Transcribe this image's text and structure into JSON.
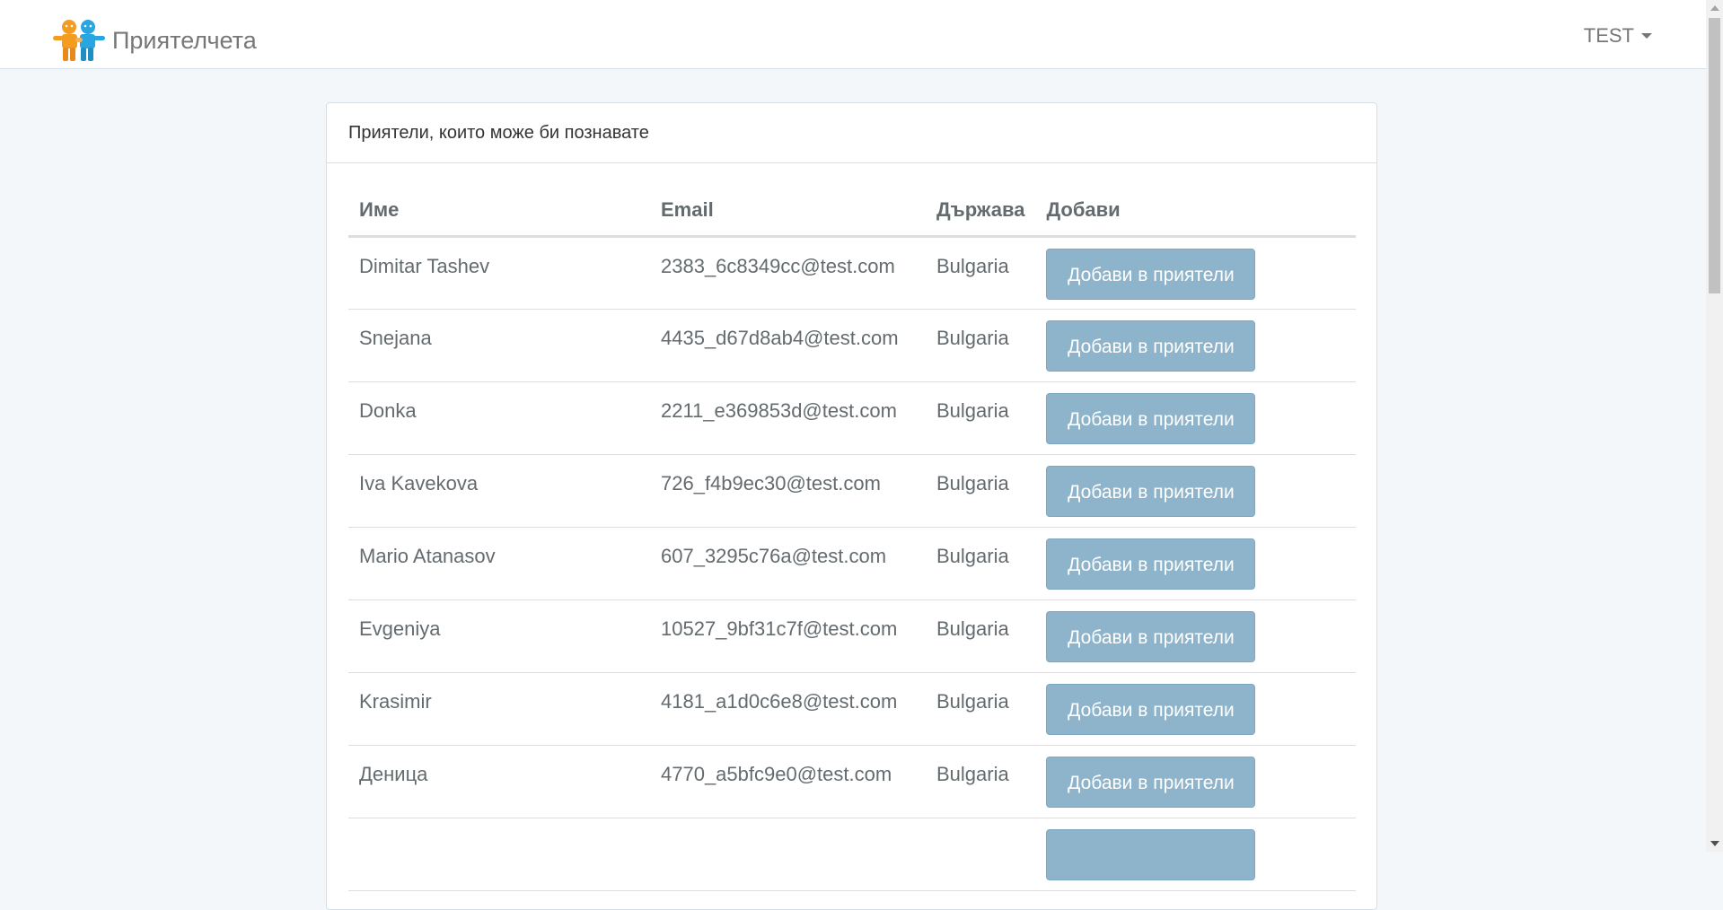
{
  "navbar": {
    "brand": "Приятелчета",
    "logo_icon": "friends-logo-icon",
    "user": "TEST"
  },
  "panel": {
    "heading": "Приятели, които може би познавате"
  },
  "table": {
    "headers": {
      "name": "Име",
      "email": "Email",
      "country": "Държава",
      "action": "Добави"
    },
    "rows": [
      {
        "name": "Dimitar Tashev",
        "email": "2383_6c8349cc@test.com",
        "country": "Bulgaria",
        "button": "Добави в приятели"
      },
      {
        "name": "Snejana",
        "email": "4435_d67d8ab4@test.com",
        "country": "Bulgaria",
        "button": "Добави в приятели"
      },
      {
        "name": "Donka",
        "email": "2211_e369853d@test.com",
        "country": "Bulgaria",
        "button": "Добави в приятели"
      },
      {
        "name": "Iva Kavekova",
        "email": "726_f4b9ec30@test.com",
        "country": "Bulgaria",
        "button": "Добави в приятели"
      },
      {
        "name": "Mario Atanasov",
        "email": "607_3295c76a@test.com",
        "country": "Bulgaria",
        "button": "Добави в приятели"
      },
      {
        "name": "Evgeniya",
        "email": "10527_9bf31c7f@test.com",
        "country": "Bulgaria",
        "button": "Добави в приятели"
      },
      {
        "name": "Krasimir",
        "email": "4181_a1d0c6e8@test.com",
        "country": "Bulgaria",
        "button": "Добави в приятели"
      },
      {
        "name": "Деница",
        "email": "4770_a5bfc9e0@test.com",
        "country": "Bulgaria",
        "button": "Добави в приятели"
      },
      {
        "name": "",
        "email": "",
        "country": "",
        "button": ""
      }
    ]
  },
  "colors": {
    "button_bg": "#8eb4cb",
    "page_bg": "#f4f7f9",
    "border": "#d3e0e9"
  }
}
